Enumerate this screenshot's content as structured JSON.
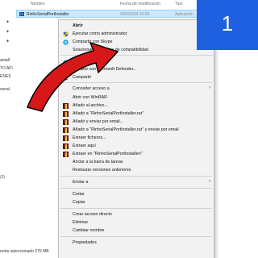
{
  "columns": {
    "name": "Nombre",
    "date_modified": "Fecha de modificación",
    "type": "Tipo"
  },
  "file": {
    "name": "RinhoSerialPortInstaller",
    "date": "30/6/2024 10:03",
    "type": "Aplicación"
  },
  "nav": {
    "items": [
      "antall",
      "TO AFI",
      "ENES",
      "sonal"
    ],
    "extra": "(3)"
  },
  "status_bar": "rento seleccionado  276 MB",
  "badge": {
    "number": "1",
    "color": "#1f60e0"
  },
  "context_menu": {
    "open": "Abrir",
    "run_as_admin": "Ejecutar como administrador",
    "share_skype": "Compartir con Skype",
    "compat": "Solucionar problemas de compatibilidad",
    "move_onedrive": "Mover a OneDrive",
    "defender": "Analizar con Microsoft Defender...",
    "share": "Compartir",
    "give_access": "Conceder acceso a",
    "open_winrar": "Abrir con WinRAR",
    "add_archive": "Añadir al archivo...",
    "add_rar": "Añadir a \"RinhoSerialPortInstaller.rar\"",
    "add_email": "Añadir y enviar por email...",
    "add_rar_email": "Añadir a \"RinhoSerialPortInstaller.rar\" y enviar por email",
    "extract_files": "Extraer ficheros...",
    "extract_here": "Extraer aquí",
    "extract_folder": "Extraer en \"RinhoSerialPortInstaller\\\"",
    "pin_taskbar": "Anclar a la barra de tareas",
    "restore": "Restaurar versiones anteriores",
    "send_to": "Enviar a",
    "cut": "Cortar",
    "copy": "Copiar",
    "create_shortcut": "Crear acceso directo",
    "delete": "Eliminar",
    "rename": "Cambiar nombre",
    "properties": "Propiedades"
  },
  "icons": {
    "shield": "uac-shield-icon",
    "skype": "skype-icon",
    "onedrive": "onedrive-icon",
    "defender": "defender-icon",
    "share": "share-icon",
    "winrar": "winrar-icon"
  },
  "colors": {
    "arrow": "#d81818",
    "selection": "#cce8ff",
    "badge": "#1f60e0"
  }
}
